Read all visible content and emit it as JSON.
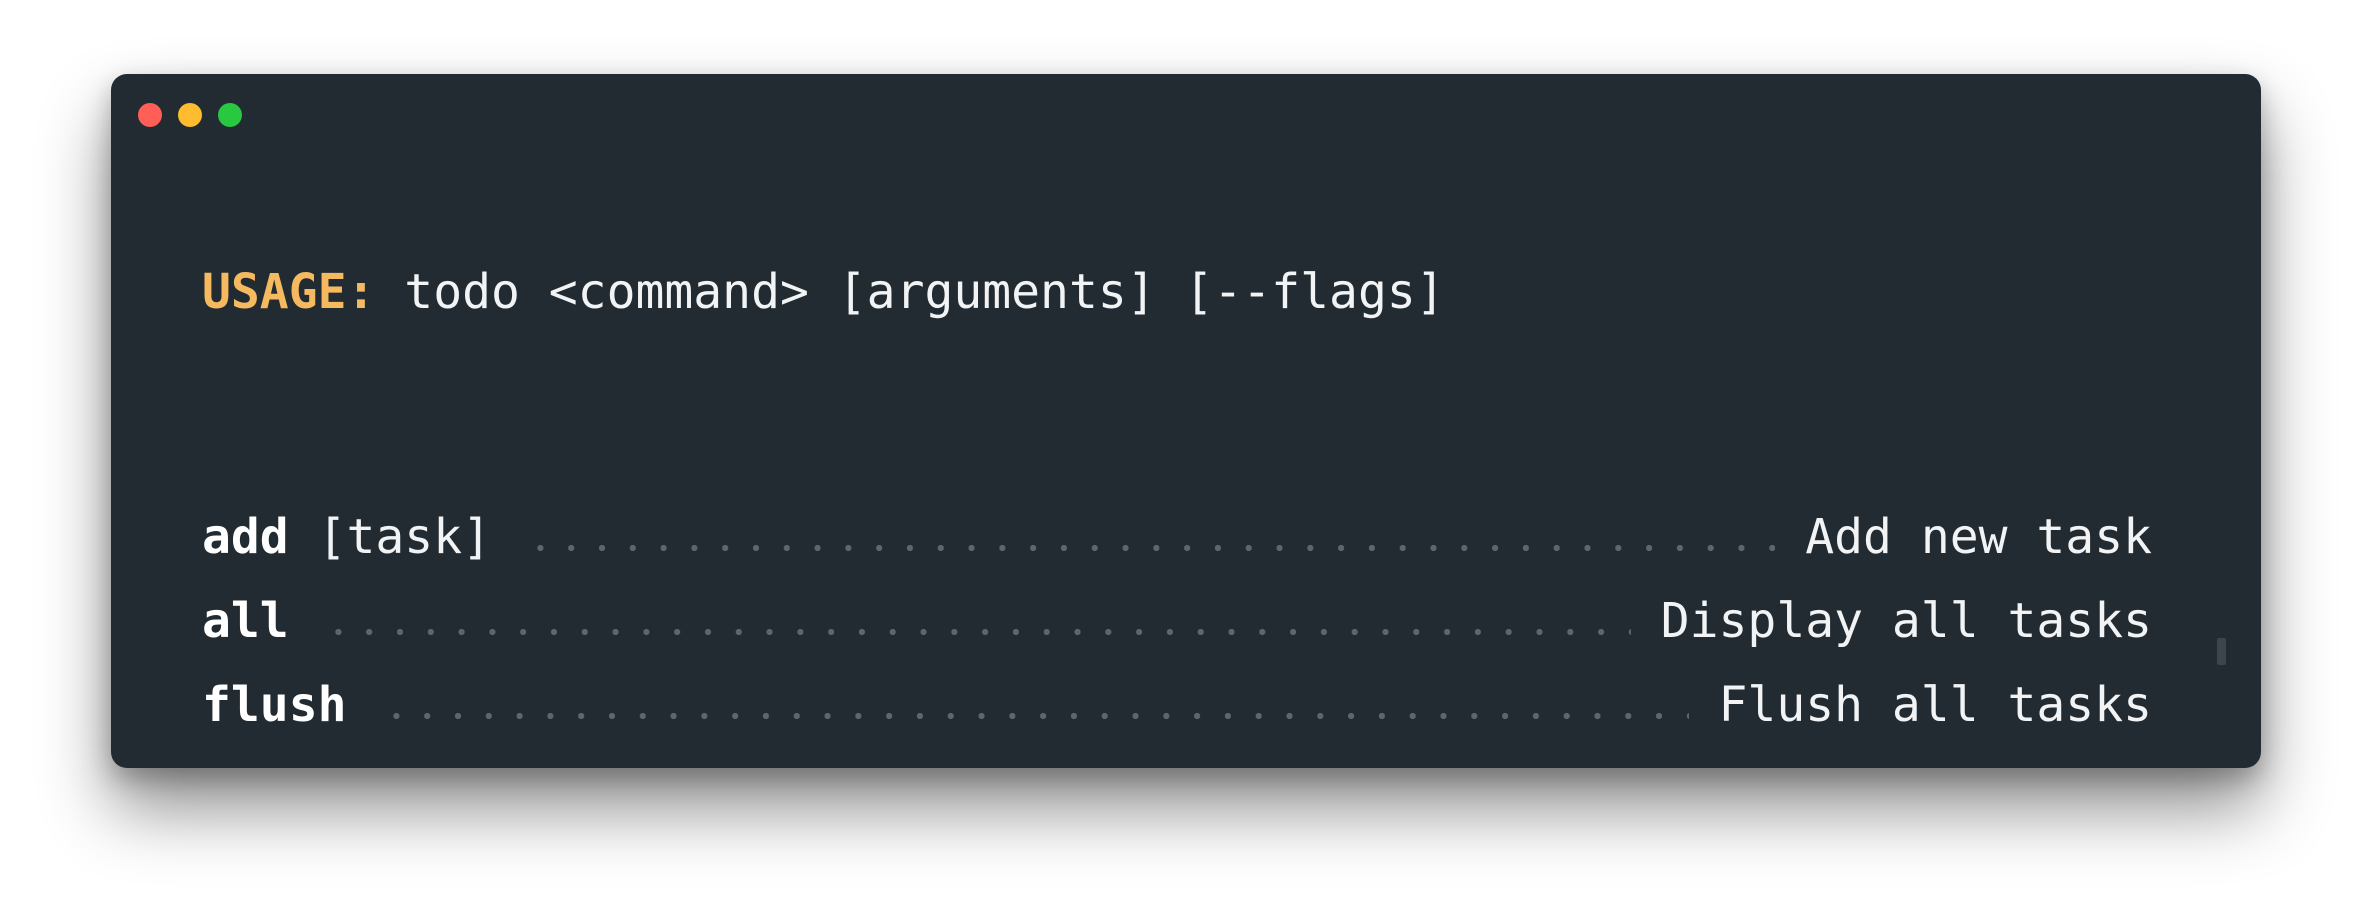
{
  "usage": {
    "label": "USAGE:",
    "text": " todo <command> [arguments] [--flags]"
  },
  "commands": [
    {
      "name": "add",
      "arg": " [task]",
      "description": "Add new task"
    },
    {
      "name": "all",
      "arg": "",
      "description": "Display all tasks"
    },
    {
      "name": "flush",
      "arg": "",
      "description": "Flush all tasks"
    }
  ],
  "colors": {
    "background": "#222b31",
    "accent": "#f5b95f",
    "text": "#f1f3f4",
    "dots": "#5d666c"
  },
  "icons": {
    "close": "close-dot-icon",
    "minimize": "minimize-dot-icon",
    "maximize": "maximize-dot-icon",
    "cursor": "text-cursor-icon"
  }
}
